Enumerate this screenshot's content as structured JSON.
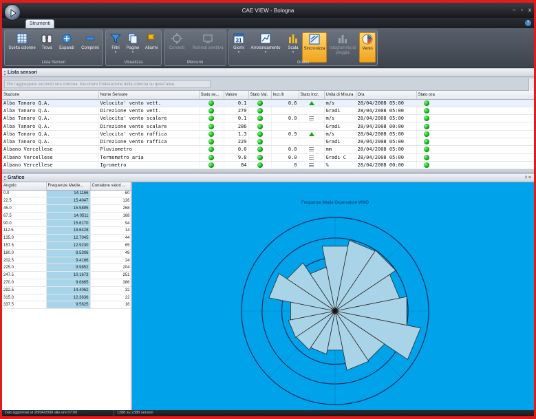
{
  "window": {
    "title": "CAE VIEW - Bologna",
    "minimize": "–",
    "restore": "▫",
    "close": "x"
  },
  "ribbon": {
    "tab": "Strumenti",
    "groups": [
      {
        "label": "Lista Sensori",
        "buttons": [
          {
            "label": "Scelta colonne",
            "icon": "grid-icon"
          },
          {
            "label": "Trova",
            "icon": "binoculars-icon"
          },
          {
            "label": "Espandi",
            "icon": "expand-icon"
          },
          {
            "label": "Comprimi",
            "icon": "collapse-icon"
          }
        ]
      },
      {
        "label": "Visualizza",
        "buttons": [
          {
            "label": "Filtri",
            "icon": "filter-icon"
          },
          {
            "label": "Pagine",
            "icon": "pages-icon"
          },
          {
            "label": "Allarmi",
            "icon": "alarm-flag-icon"
          }
        ]
      },
      {
        "label": "Mercurio",
        "buttons": [
          {
            "label": "Connetti",
            "icon": "connect-icon"
          },
          {
            "label": "Richiedi selettiva",
            "icon": "request-icon"
          }
        ]
      },
      {
        "label": "Grafici",
        "buttons": [
          {
            "label": "Giorni",
            "icon": "calendar-icon",
            "badge": "31"
          },
          {
            "label": "Arrotondamento",
            "icon": "rounding-icon"
          },
          {
            "label": "Scala",
            "icon": "scale-icon"
          },
          {
            "label": "Sincronizza",
            "icon": "sync-icon"
          },
          {
            "label": "Istogramma di pioggia",
            "icon": "histogram-icon"
          },
          {
            "label": "Vento",
            "icon": "wind-icon"
          }
        ]
      }
    ]
  },
  "sensors_panel": {
    "title": "Lista sensori",
    "grouping_hint": "Per raggruppare secondo una colonna, trascinare l'intestazione della colonna su quest'area.",
    "columns": [
      "Stazione",
      "Nome Sensore",
      "Stato se...",
      "Valore",
      "Stato Val.",
      "Incr./h",
      "Stato Incr.",
      "Unità di Misura",
      "Ora",
      "Stato ora"
    ],
    "rows": [
      {
        "station": "Alba Tanaro Q.A.",
        "sensor": "Velocita' vento vett.",
        "value": "0.1",
        "incr": "0.6",
        "incr_state": "up",
        "unit": "m/s",
        "time": "28/04/2008 05:00"
      },
      {
        "station": "Alba Tanaro Q.A.",
        "sensor": "Direzione vento vett.",
        "value": "270",
        "incr": "",
        "incr_state": "",
        "unit": "Gradi",
        "time": "28/04/2008 05:00"
      },
      {
        "station": "Alba Tanaro Q.A.",
        "sensor": "Velocita' vento scalare",
        "value": "0.1",
        "incr": "0.0",
        "incr_state": "eq",
        "unit": "m/s",
        "time": "28/04/2008 05:00"
      },
      {
        "station": "Alba Tanaro Q.A.",
        "sensor": "Direzione vento scalare",
        "value": "286",
        "incr": "",
        "incr_state": "",
        "unit": "Gradi",
        "time": "28/04/2008 00:00"
      },
      {
        "station": "Alba Tanaro Q.A.",
        "sensor": "Velocita' vento raffica",
        "value": "1.3",
        "incr": "0.9",
        "incr_state": "up",
        "unit": "m/s",
        "time": "28/04/2008 05:00"
      },
      {
        "station": "Alba Tanaro Q.A.",
        "sensor": "Direzione vento raffica",
        "value": "229",
        "incr": "",
        "incr_state": "",
        "unit": "Gradi",
        "time": "28/04/2008 05:00"
      },
      {
        "station": "Albano Vercellese",
        "sensor": "Pluviometro",
        "value": "0.0",
        "incr": "0.0",
        "incr_state": "eq",
        "unit": "mm",
        "time": "28/04/2008 05:00"
      },
      {
        "station": "Albano Vercellese",
        "sensor": "Termometro aria",
        "value": "9.8",
        "incr": "0.0",
        "incr_state": "eq",
        "unit": "Gradi C",
        "time": "28/04/2008 05:00"
      },
      {
        "station": "Albano Vercellese",
        "sensor": "Igrometro",
        "value": "84",
        "incr": "0",
        "incr_state": "eq",
        "unit": "%",
        "time": "28/04/2008 00:00"
      }
    ]
  },
  "chart_panel": {
    "title": "Grafico",
    "columns": [
      "Angolo",
      "Frequenze Medie...",
      "Contatore valori ..."
    ]
  },
  "chart_data": {
    "type": "rose",
    "title": "Frequenze Medie Osservatore WMO",
    "rmax": 20,
    "directions": [
      "0.0",
      "22.5",
      "45.0",
      "67.5",
      "90.0",
      "112.5",
      "135.0",
      "157.5",
      "180.0",
      "202.5",
      "225.0",
      "247.5",
      "270.0",
      "292.5",
      "315.0",
      "337.5"
    ],
    "frequencies": [
      14.1166,
      15.4047,
      15.5895,
      14.0511,
      15.617,
      18.6428,
      12.7045,
      12.923,
      8.5306,
      9.4166,
      9.9852,
      10.1673,
      9.6865,
      14.4062,
      12.3636,
      9.5625
    ],
    "counts": [
      60,
      126,
      268,
      168,
      94,
      14,
      44,
      65,
      49,
      24,
      204,
      251,
      386,
      32,
      22,
      16
    ]
  },
  "status": {
    "left": "Dati aggiornati al 28/04/2008 alle ore 07:00",
    "right": "1288 su 2388 sensori"
  }
}
